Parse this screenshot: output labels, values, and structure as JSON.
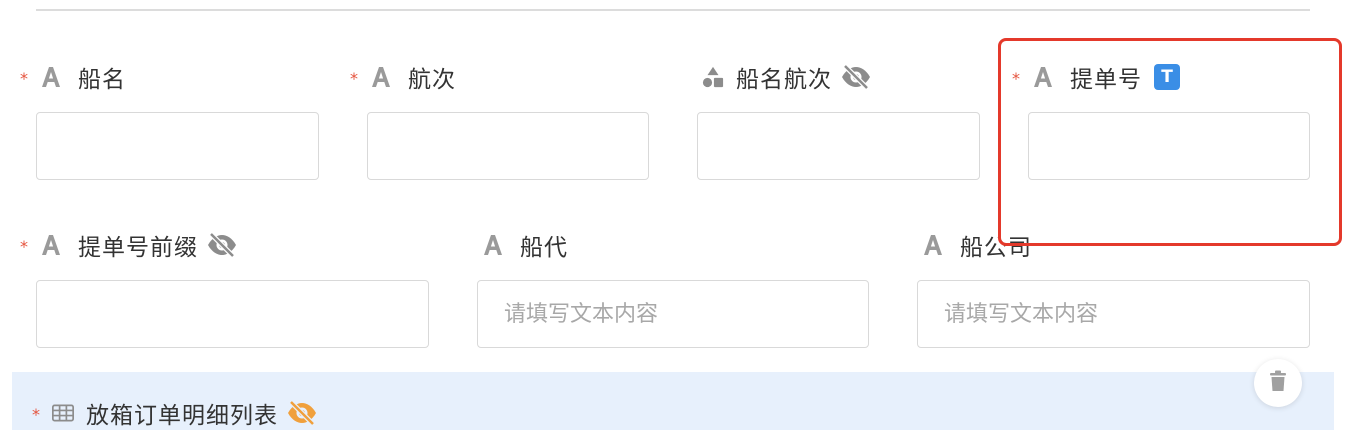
{
  "form": {
    "fields": [
      {
        "label": "船名",
        "required": true,
        "value": "",
        "placeholder": ""
      },
      {
        "label": "航次",
        "required": true,
        "value": "",
        "placeholder": ""
      },
      {
        "label": "船名航次",
        "required": false,
        "hidden_indicator": "eye-off-icon",
        "value": "",
        "placeholder": ""
      },
      {
        "label": "提单号",
        "required": true,
        "badge": "T",
        "value": "",
        "placeholder": ""
      },
      {
        "label": "提单号前缀",
        "required": true,
        "hidden_indicator": "eye-off-icon",
        "value": "",
        "placeholder": ""
      },
      {
        "label": "船代",
        "required": false,
        "value": "",
        "placeholder": "请填写文本内容"
      },
      {
        "label": "船公司",
        "required": false,
        "value": "",
        "placeholder": "请填写文本内容"
      }
    ],
    "required_mark": "*",
    "icons": {
      "text_type": "text-type-icon",
      "shapes_type": "shapes-type-icon",
      "table_type": "table-type-icon",
      "hidden": "eye-off-icon",
      "delete": "trash-icon"
    }
  },
  "table_section": {
    "label": "放箱订单明细列表",
    "required": true
  },
  "colors": {
    "required_mark": "#e5533d",
    "highlight_border": "#e4392b",
    "badge_bg": "#3a8ee6",
    "table_section_bg": "#e7f0fc",
    "table_hidden_icon": "#f0a03c"
  }
}
